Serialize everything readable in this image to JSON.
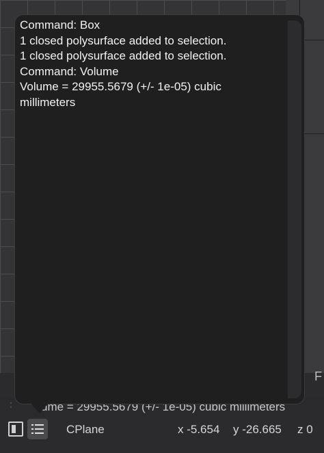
{
  "popup": {
    "lines": [
      "Command: Box",
      "1 closed polysurface added to selection.",
      "1 closed polysurface added to selection.",
      "Command: Volume",
      "Volume = 29955.5679 (+/- 1e-05) cubic millimeters"
    ]
  },
  "command_line": {
    "history_text": "ume = 29955.5679 (+/- 1e-05) cubic millimeters"
  },
  "status_bar": {
    "cplane_label": "CPlane",
    "x": "x -5.654",
    "y": "y -26.665",
    "z": "z 0"
  },
  "side_letter": "F",
  "colors": {
    "popup_bg": "#1f1f20",
    "app_bg": "#2b2b2d",
    "text": "#f2f2f2"
  },
  "icons": [
    "layout-toggle-icon",
    "list-icon",
    "drag-handle-icon"
  ]
}
